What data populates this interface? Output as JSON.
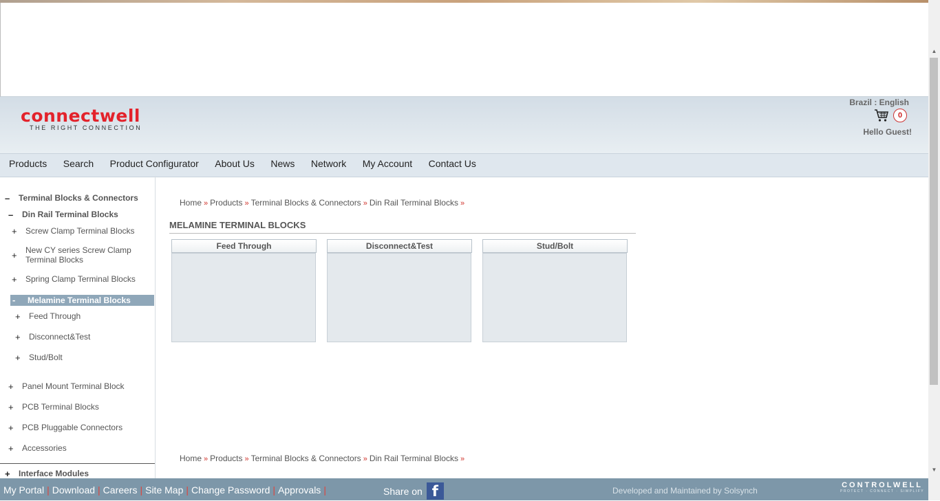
{
  "brand": {
    "name": "connectwell",
    "tagline": "THE RIGHT CONNECTION",
    "color": "#e3222b"
  },
  "header": {
    "locale": "Brazil : English",
    "cart_count": "0",
    "greeting": "Hello Guest!"
  },
  "nav": [
    "Products",
    "Search",
    "Product Configurator",
    "About Us",
    "News",
    "Network",
    "My Account",
    "Contact Us"
  ],
  "sidebar": {
    "items": [
      {
        "sign": "–",
        "label": "Terminal Blocks & Connectors"
      },
      {
        "sign": "–",
        "label": "Din Rail Terminal Blocks"
      },
      {
        "sign": "+",
        "label": "Screw Clamp Terminal Blocks"
      },
      {
        "sign": "+",
        "label": "New CY series Screw Clamp Terminal Blocks"
      },
      {
        "sign": "+",
        "label": "Spring Clamp Terminal Blocks"
      },
      {
        "sign": "-",
        "label": "Melamine Terminal Blocks"
      },
      {
        "sign": "+",
        "label": "Feed Through"
      },
      {
        "sign": "+",
        "label": "Disconnect&Test"
      },
      {
        "sign": "+",
        "label": "Stud/Bolt"
      },
      {
        "sign": "+",
        "label": "Panel Mount Terminal Block"
      },
      {
        "sign": "+",
        "label": "PCB Terminal Blocks"
      },
      {
        "sign": "+",
        "label": "PCB Pluggable Connectors"
      },
      {
        "sign": "+",
        "label": "Accessories"
      },
      {
        "sign": "+",
        "label": "Interface Modules"
      }
    ]
  },
  "breadcrumb": [
    "Home",
    "Products",
    "Terminal Blocks & Connectors",
    "Din Rail Terminal Blocks"
  ],
  "breadcrumb_sep": "»",
  "page_title": "MELAMINE TERMINAL BLOCKS",
  "categories": [
    "Feed Through",
    "Disconnect&Test",
    "Stud/Bolt"
  ],
  "footer": {
    "links": [
      "My Portal",
      "Download",
      "Careers",
      "Site Map",
      "Change Password",
      "Approvals"
    ],
    "share_label": "Share on",
    "developer": "Developed and Maintained by Solsynch",
    "partner_logo": {
      "text": "CONTROLWELL",
      "tagline": "PROTECT · CONNECT · SIMPLIFY"
    }
  }
}
